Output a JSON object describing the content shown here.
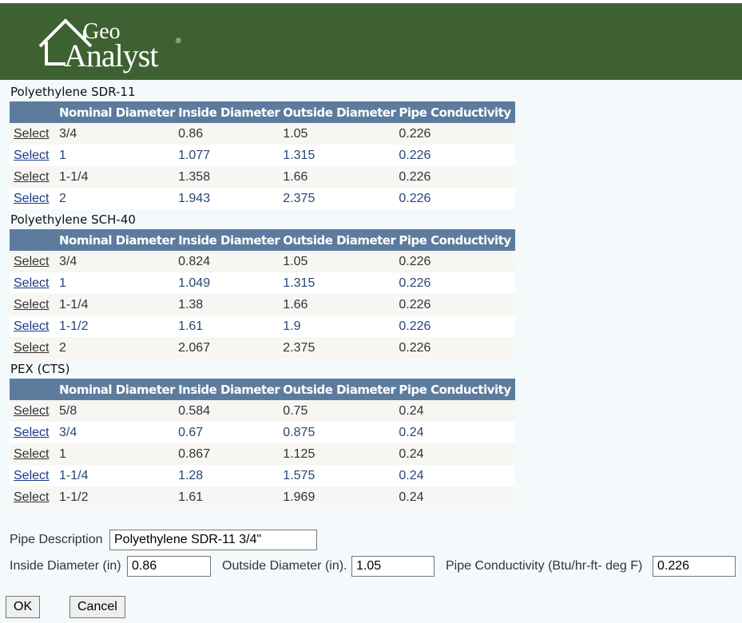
{
  "brand": {
    "logo_top": "Geo",
    "logo_bottom": "Analyst",
    "reg_mark": "®"
  },
  "colors": {
    "header_bg": "#3e6131",
    "table_header_bg": "#5d7b9d",
    "page_bg": "#f4f9fc"
  },
  "columns": [
    "Nominal Diameter",
    "Inside Diameter",
    "Outside Diameter",
    "Pipe Conductivity"
  ],
  "select_label": "Select",
  "sections": [
    {
      "title": "Polyethylene SDR-11",
      "rows": [
        [
          "3/4",
          "0.86",
          "1.05",
          "0.226"
        ],
        [
          "1",
          "1.077",
          "1.315",
          "0.226"
        ],
        [
          "1-1/4",
          "1.358",
          "1.66",
          "0.226"
        ],
        [
          "2",
          "1.943",
          "2.375",
          "0.226"
        ]
      ]
    },
    {
      "title": "Polyethylene SCH-40",
      "rows": [
        [
          "3/4",
          "0.824",
          "1.05",
          "0.226"
        ],
        [
          "1",
          "1.049",
          "1.315",
          "0.226"
        ],
        [
          "1-1/4",
          "1.38",
          "1.66",
          "0.226"
        ],
        [
          "1-1/2",
          "1.61",
          "1.9",
          "0.226"
        ],
        [
          "2",
          "2.067",
          "2.375",
          "0.226"
        ]
      ]
    },
    {
      "title": "PEX (CTS)",
      "rows": [
        [
          "5/8",
          "0.584",
          "0.75",
          "0.24"
        ],
        [
          "3/4",
          "0.67",
          "0.875",
          "0.24"
        ],
        [
          "1",
          "0.867",
          "1.125",
          "0.24"
        ],
        [
          "1-1/4",
          "1.28",
          "1.575",
          "0.24"
        ],
        [
          "1-1/2",
          "1.61",
          "1.969",
          "0.24"
        ]
      ]
    }
  ],
  "form": {
    "pipe_description_label": "Pipe Description",
    "pipe_description_value": "Polyethylene SDR-11 3/4\"",
    "inside_diameter_label": "Inside Diameter (in)",
    "inside_diameter_value": "0.86",
    "outside_diameter_label": "Outside Diameter (in).",
    "outside_diameter_value": "1.05",
    "pipe_conductivity_label": "Pipe Conductivity (Btu/hr-ft- deg F)",
    "pipe_conductivity_value": "0.226"
  },
  "buttons": {
    "ok": "OK",
    "cancel": "Cancel"
  }
}
